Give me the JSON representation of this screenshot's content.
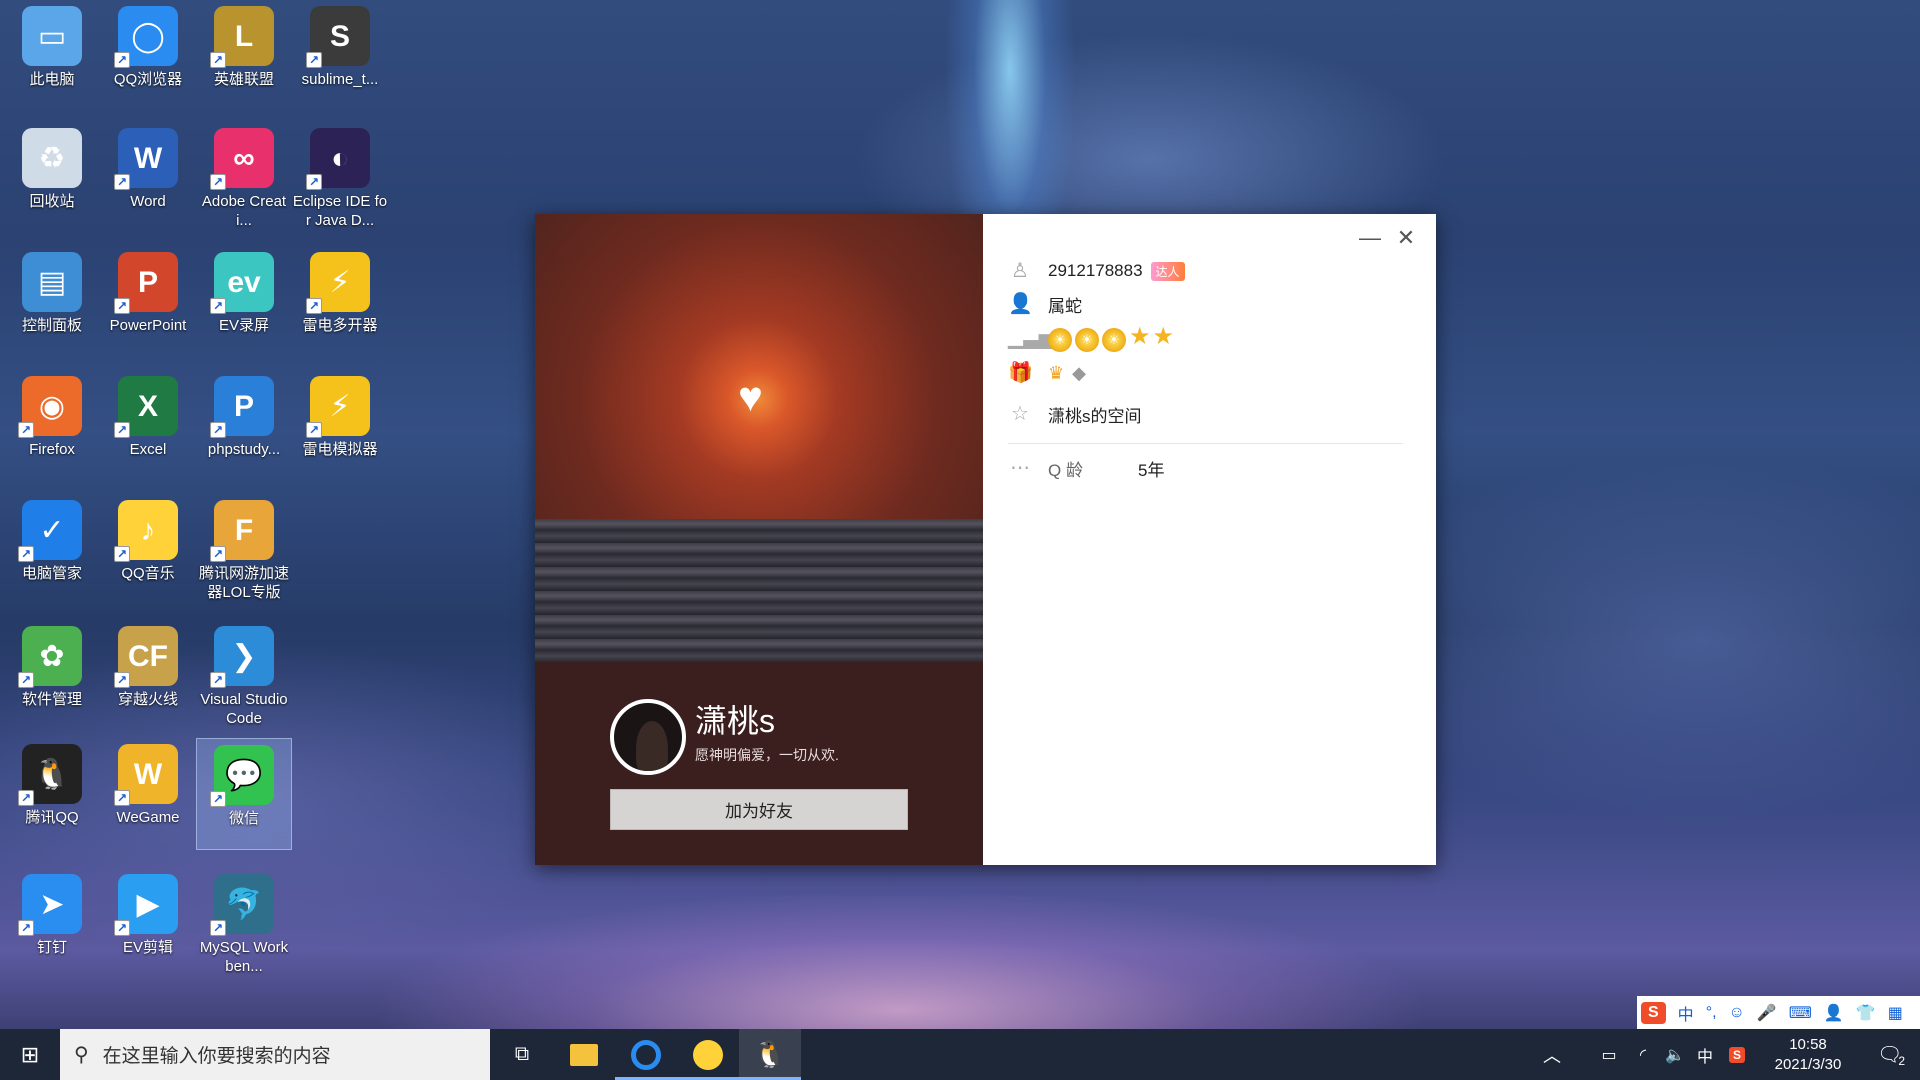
{
  "desktop_icons": [
    {
      "label": "此电脑",
      "icon": "computer-icon",
      "color": "#5aa6e8"
    },
    {
      "label": "QQ浏览器",
      "icon": "qq-browser-icon",
      "color": "#2a8cf0"
    },
    {
      "label": "英雄联盟",
      "icon": "league-of-legends-icon",
      "color": "#b8932e"
    },
    {
      "label": "sublime_t...",
      "icon": "sublime-text-icon",
      "color": "#3b3b3b"
    },
    {
      "label": "回收站",
      "icon": "recycle-bin-icon",
      "color": "#cfdbe6"
    },
    {
      "label": "Word",
      "icon": "word-icon",
      "color": "#2b5fb8"
    },
    {
      "label": "Adobe Creati...",
      "icon": "adobe-cc-icon",
      "color": "#e8306d"
    },
    {
      "label": "Eclipse IDE for Java D...",
      "icon": "eclipse-icon",
      "color": "#2c2255"
    },
    {
      "label": "控制面板",
      "icon": "control-panel-icon",
      "color": "#3e8ed6"
    },
    {
      "label": "PowerPoint",
      "icon": "powerpoint-icon",
      "color": "#d2472b"
    },
    {
      "label": "EV录屏",
      "icon": "ev-recorder-icon",
      "color": "#3cc6c2"
    },
    {
      "label": "雷电多开器",
      "icon": "ldmulti-icon",
      "color": "#f5c21b"
    },
    {
      "label": "Firefox",
      "icon": "firefox-icon",
      "color": "#ec6b2b"
    },
    {
      "label": "Excel",
      "icon": "excel-icon",
      "color": "#1f7a43"
    },
    {
      "label": "phpstudy...",
      "icon": "phpstudy-icon",
      "color": "#2a7fd8"
    },
    {
      "label": "雷电模拟器",
      "icon": "ldplayer-icon",
      "color": "#f5c21b"
    },
    {
      "label": "电脑管家",
      "icon": "pc-manager-icon",
      "color": "#1f7ee8"
    },
    {
      "label": "QQ音乐",
      "icon": "qq-music-icon",
      "color": "#ffd23a"
    },
    {
      "label": "腾讯网游加速器LOL专版",
      "icon": "game-accelerator-icon",
      "color": "#e8a53a"
    },
    {
      "label": "软件管理",
      "icon": "software-manager-icon",
      "color": "#4caf50"
    },
    {
      "label": "穿越火线",
      "icon": "crossfire-icon",
      "color": "#c8a24a"
    },
    {
      "label": "Visual Studio Code",
      "icon": "vscode-icon",
      "color": "#2d8cd8"
    },
    {
      "label": "腾讯QQ",
      "icon": "qq-icon",
      "color": "#222222"
    },
    {
      "label": "WeGame",
      "icon": "wegame-icon",
      "color": "#f0b42a"
    },
    {
      "label": "微信",
      "icon": "wechat-icon",
      "color": "#31c24f"
    },
    {
      "label": "钉钉",
      "icon": "dingtalk-icon",
      "color": "#2a8ef0"
    },
    {
      "label": "EV剪辑",
      "icon": "ev-editor-icon",
      "color": "#2a9ef0"
    },
    {
      "label": "MySQL Workben...",
      "icon": "mysql-workbench-icon",
      "color": "#2f6f8c"
    }
  ],
  "profile": {
    "nickname": "潇桃s",
    "signature": "愿神明偏爱，一切从欢.",
    "add_friend_label": "加为好友",
    "qq_number": "2912178883",
    "talent_badge": "达人",
    "zodiac": "属蛇",
    "level_suns": 3,
    "level_stars": 2,
    "space_link": "潇桃s的空间",
    "qage_label": "Q 龄",
    "qage_value": "5年"
  },
  "window_controls": {
    "minimize": "—",
    "close": "✕"
  },
  "taskbar": {
    "search_placeholder": "在这里输入你要搜索的内容",
    "time": "10:58",
    "date": "2021/3/30",
    "ime_indicator": "中",
    "notification_count": "2"
  },
  "ime_toolbar": {
    "logo": "S",
    "mode": "中",
    "punct": "°,"
  }
}
